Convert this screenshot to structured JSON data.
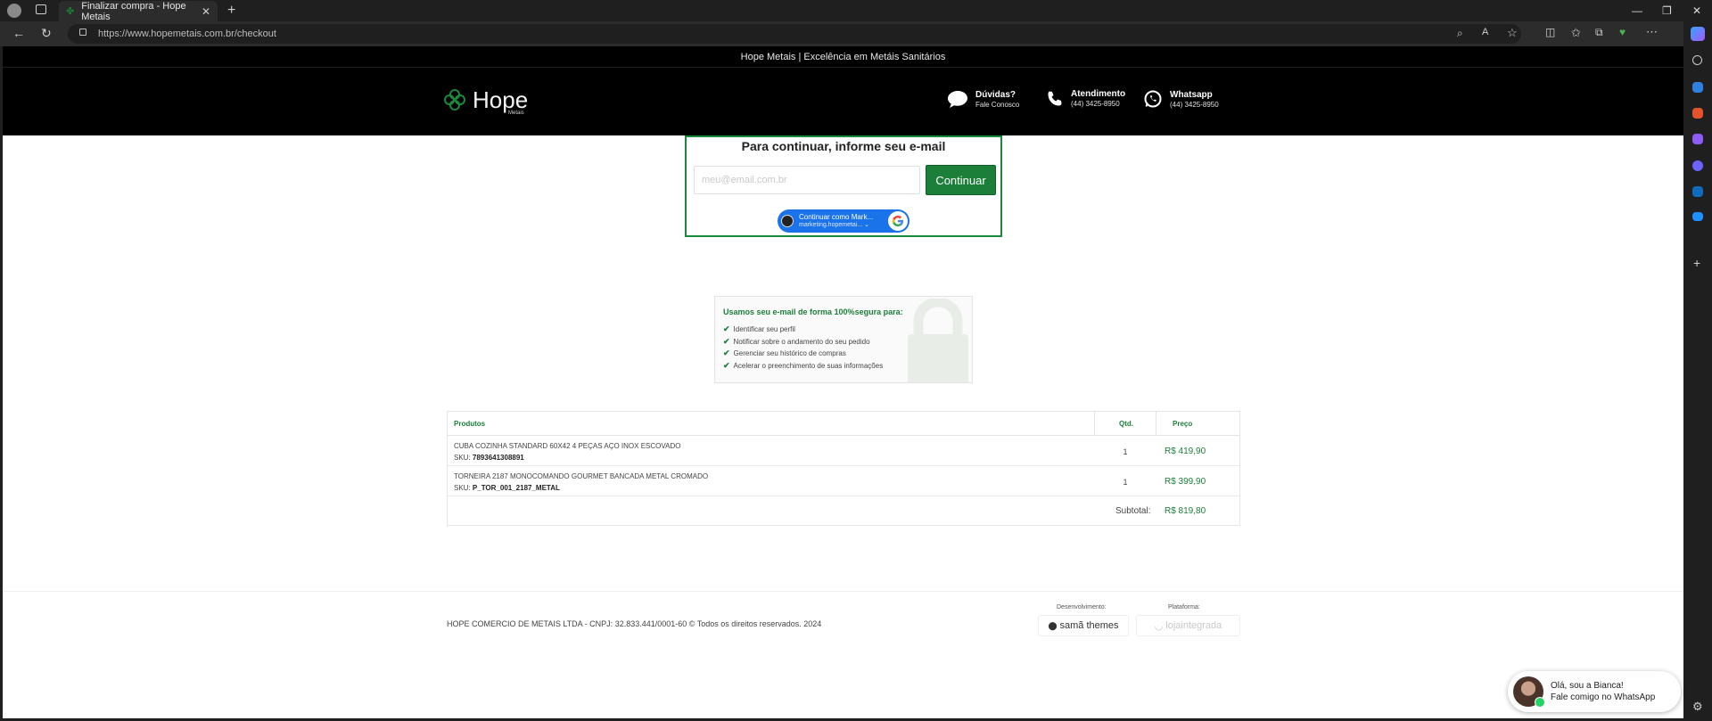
{
  "browser": {
    "tab_title": "Finalizar compra - Hope Metais",
    "url": "https://www.hopemetais.com.br/checkout"
  },
  "announcement": "Hope Metais | Excelência em Metáis Sanitários",
  "header": {
    "logo_text": "Hope",
    "logo_subtext": "Metais",
    "duvidas": {
      "title": "Dúvidas?",
      "subtitle": "Fale Conosco"
    },
    "atendimento": {
      "title": "Atendimento",
      "subtitle": "(44) 3425-8950"
    },
    "whatsapp": {
      "title": "Whatsapp",
      "subtitle": "(44) 3425-8950"
    }
  },
  "email_form": {
    "heading": "Para continuar, informe seu e-mail",
    "placeholder": "meu@email.com.br",
    "continue_label": "Continuar",
    "google_line1": "Continuar como Mark...",
    "google_line2": "marketing.hopemetai..."
  },
  "security": {
    "heading": "Usamos seu e-mail de forma 100%segura para:",
    "items": [
      "Identificar seu perfil",
      "Notificar sobre o andamento do seu pedido",
      "Gerenciar seu histórico de compras",
      "Acelerar o preenchimento de suas informações"
    ]
  },
  "cart": {
    "headers": {
      "product": "Produtos",
      "qty": "Qtd.",
      "price": "Preço"
    },
    "rows": [
      {
        "name": "CUBA COZINHA STANDARD 60X42 4 PEÇAS AÇO INOX ESCOVADO",
        "sku_label": "SKU:",
        "sku": "7893641308891",
        "qty": "1",
        "price": "R$ 419,90"
      },
      {
        "name": "TORNEIRA 2187 MONOCOMANDO GOURMET BANCADA METAL CROMADO",
        "sku_label": "SKU:",
        "sku": "P_TOR_001_2187_METAL",
        "qty": "1",
        "price": "R$ 399,90"
      }
    ],
    "subtotal_label": "Subtotal:",
    "subtotal_value": "R$ 819,80"
  },
  "footer": {
    "copyright": "HOPE COMERCIO DE METAIS LTDA - CNPJ: 32.833.441/0001-60 © Todos os direitos reservados. 2024",
    "dev_label": "Desenvolvimento:",
    "dev_name": "samã themes",
    "platform_label": "Plataforma:",
    "platform_name": "lojaintegrada"
  },
  "whatsapp_widget": {
    "line1": "Olá, sou a Bianca!",
    "line2": "Fale comigo no WhatsApp"
  },
  "colors": {
    "brand_green": "#1b7f3a",
    "google_blue": "#1a73e8",
    "whatsapp_green": "#25d366"
  }
}
